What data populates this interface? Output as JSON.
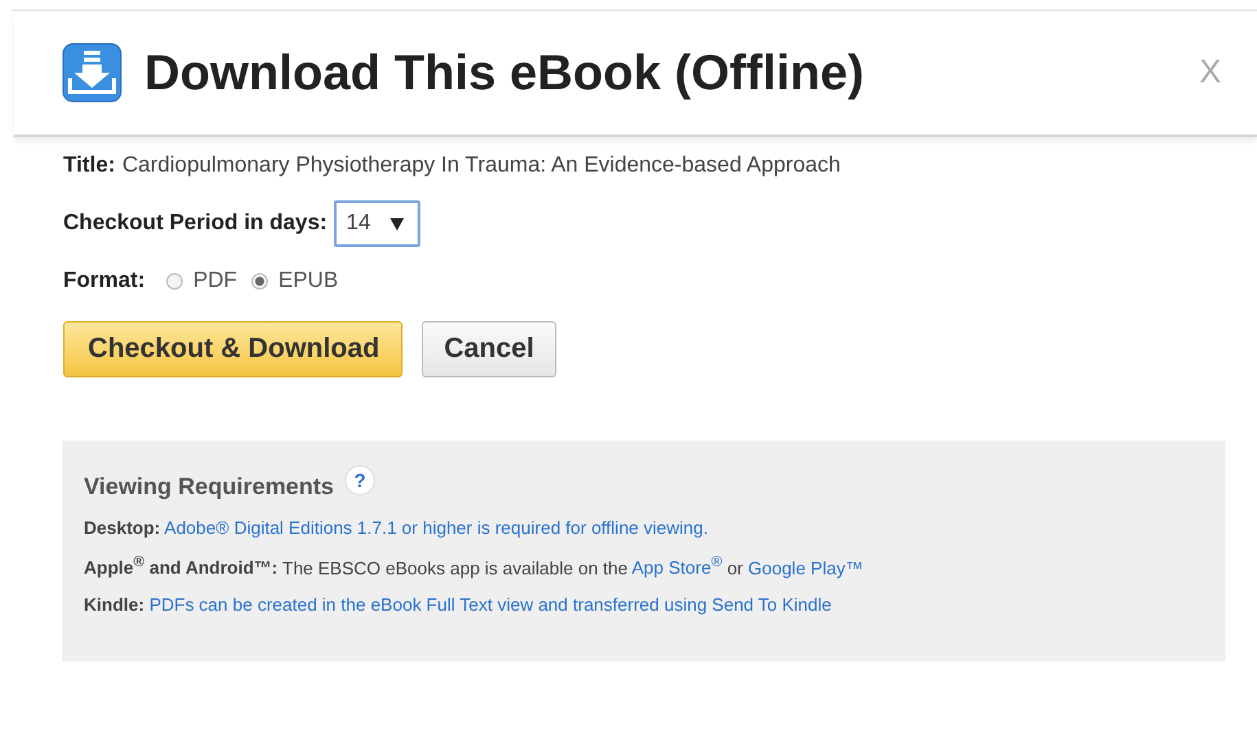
{
  "dialog": {
    "title": "Download This eBook (Offline)",
    "close": "X"
  },
  "title_field": {
    "label": "Title:",
    "value": "Cardiopulmonary Physiotherapy In Trauma: An Evidence-based Approach"
  },
  "checkout_period": {
    "label": "Checkout Period in days:",
    "value": "14"
  },
  "format": {
    "label": "Format:",
    "options": [
      {
        "label": "PDF",
        "selected": false
      },
      {
        "label": "EPUB",
        "selected": true
      }
    ]
  },
  "buttons": [
    {
      "label": "Checkout & Download",
      "kind": "primary"
    },
    {
      "label": "Cancel",
      "kind": "secondary"
    }
  ],
  "requirements": {
    "heading": "Viewing Requirements",
    "help": "?",
    "lines": [
      {
        "segments": [
          {
            "kind": "text",
            "text": "**Desktop:** "
          },
          {
            "kind": "link",
            "text": "Adobe® Digital Editions 1.7.1 or higher is required for offline viewing."
          }
        ]
      },
      {
        "segments": [
          {
            "kind": "text",
            "text": "**Apple$^{®}$ and Android™:** The EBSCO eBooks app is available on the "
          },
          {
            "kind": "link",
            "text": "App Store$^{®}$"
          },
          {
            "kind": "text",
            "text": " or "
          },
          {
            "kind": "link",
            "text": "Google Play™"
          }
        ]
      },
      {
        "segments": [
          {
            "kind": "text",
            "text": "**Kindle:** "
          },
          {
            "kind": "link",
            "text": "PDFs can be created in the eBook Full Text view and transferred using Send To Kindle"
          }
        ]
      }
    ]
  }
}
